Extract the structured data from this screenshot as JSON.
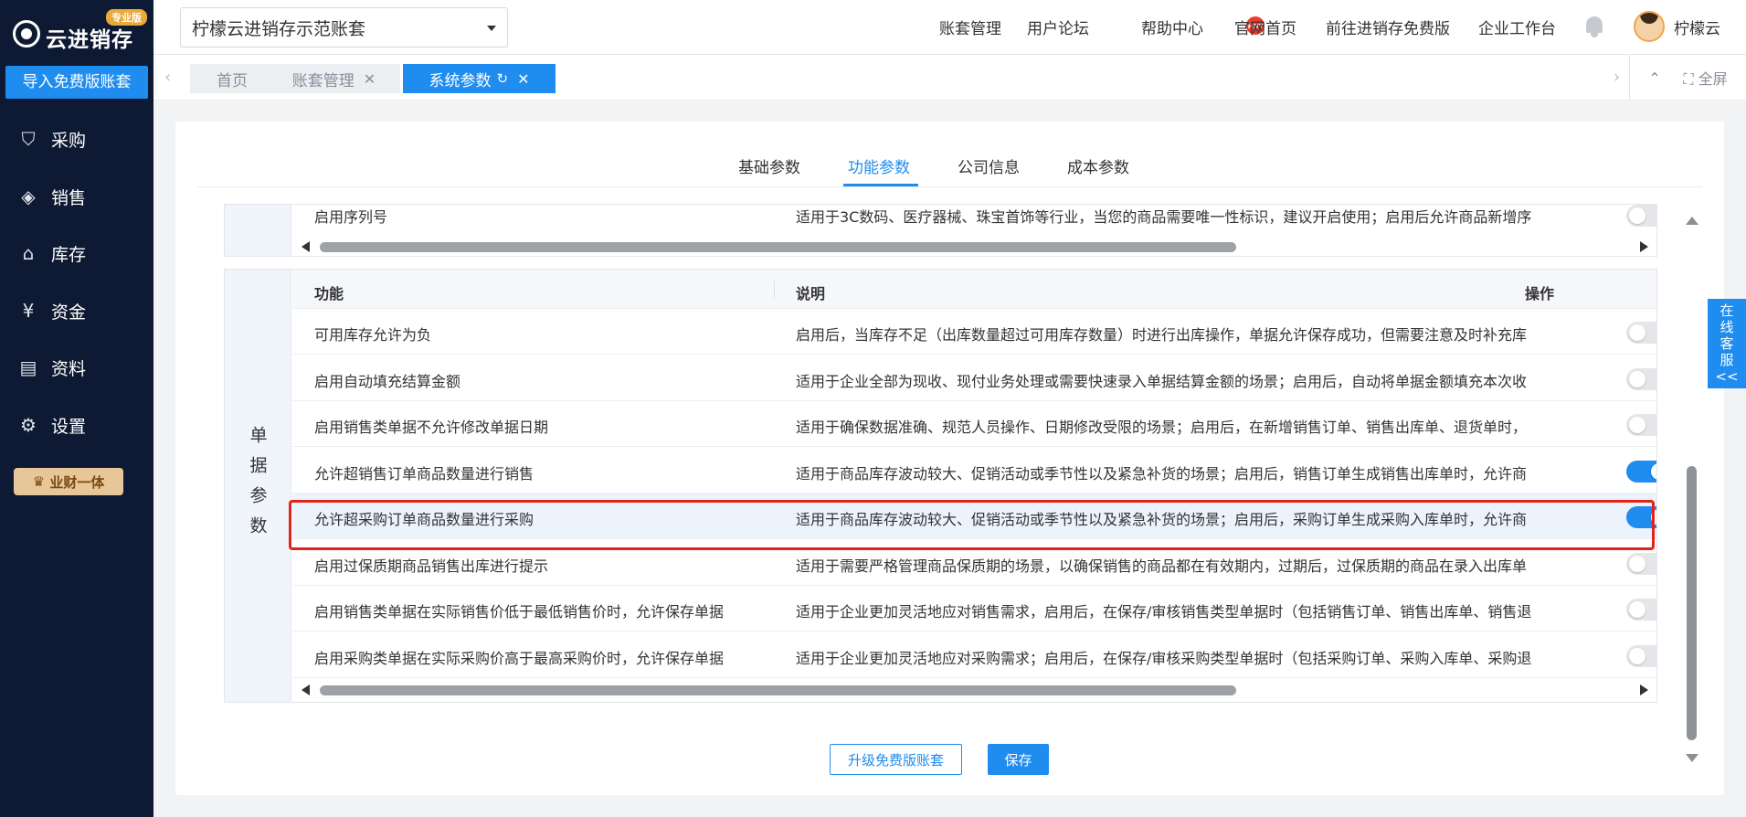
{
  "sidebar": {
    "logo_text": "云进销存",
    "logo_badge": "专业版",
    "import_button": "导入免费版账套",
    "items": [
      {
        "label": "采购",
        "icon": "bag-icon",
        "glyph": "⛉"
      },
      {
        "label": "销售",
        "icon": "price-tag-icon",
        "glyph": "◈"
      },
      {
        "label": "库存",
        "icon": "warehouse-icon",
        "glyph": "⌂"
      },
      {
        "label": "资金",
        "icon": "yen-coin-icon",
        "glyph": "¥"
      },
      {
        "label": "资料",
        "icon": "document-icon",
        "glyph": "▤"
      },
      {
        "label": "设置",
        "icon": "gear-icon",
        "glyph": "⚙"
      }
    ],
    "vip_label": "业财一体"
  },
  "topbar": {
    "account": "柠檬云进销存示范账套",
    "links": [
      "账套管理",
      "用户论坛",
      "帮助中心",
      "官网首页",
      "前往进销存免费版",
      "企业工作台"
    ],
    "hot_badge": "HOT",
    "username": "柠檬云"
  },
  "tabs": {
    "items": [
      "首页",
      "账套管理",
      "系统参数"
    ],
    "active": "系统参数",
    "fullscreen_label": "全屏"
  },
  "page_tabs": {
    "items": [
      "基础参数",
      "功能参数",
      "公司信息",
      "成本参数"
    ],
    "active": "功能参数"
  },
  "top_block": {
    "row": {
      "func": "启用序列号",
      "desc": "适用于3C数码、医疗器械、珠宝首饰等行业，当您的商品需要唯一性标识，建议开启使用；启用后允许商品新增序",
      "enabled": false
    }
  },
  "table": {
    "group_label": "单据参数",
    "headers": {
      "func": "功能",
      "desc": "说明",
      "op": "操作"
    },
    "rows": [
      {
        "func": "可用库存允许为负",
        "desc": "启用后，当库存不足（出库数量超过可用库存数量）时进行出库操作，单据允许保存成功，但需要注意及时补充库",
        "enabled": false
      },
      {
        "func": "启用自动填充结算金额",
        "desc": "适用于企业全部为现收、现付业务处理或需要快速录入单据结算金额的场景；启用后，自动将单据金额填充本次收",
        "enabled": false
      },
      {
        "func": "启用销售类单据不允许修改单据日期",
        "desc": "适用于确保数据准确、规范人员操作、日期修改受限的场景；启用后，在新增销售订单、销售出库单、退货单时，",
        "enabled": false
      },
      {
        "func": "允许超销售订单商品数量进行销售",
        "desc": "适用于商品库存波动较大、促销活动或季节性以及紧急补货的场景；启用后，销售订单生成销售出库单时，允许商",
        "enabled": true
      },
      {
        "func": "允许超采购订单商品数量进行采购",
        "desc": "适用于商品库存波动较大、促销活动或季节性以及紧急补货的场景；启用后，采购订单生成采购入库单时，允许商",
        "enabled": true,
        "highlighted": true
      },
      {
        "func": "启用过保质期商品销售出库进行提示",
        "desc": "适用于需要严格管理商品保质期的场景，以确保销售的商品都在有效期内，过期后，过保质期的商品在录入出库单",
        "enabled": false
      },
      {
        "func": "启用销售类单据在实际销售价低于最低销售价时，允许保存单据",
        "desc": "适用于企业更加灵活地应对销售需求，启用后，在保存/审核销售类型单据时（包括销售订单、销售出库单、销售退",
        "enabled": false
      },
      {
        "func": "启用采购类单据在实际采购价高于最高采购价时，允许保存单据",
        "desc": "适用于企业更加灵活地应对采购需求；启用后，在保存/审核采购类型单据时（包括采购订单、采购入库单、采购退",
        "enabled": false
      }
    ]
  },
  "buttons": {
    "upgrade": "升级免费版账套",
    "save": "保存"
  },
  "customer_service": [
    "在",
    "线",
    "客",
    "服",
    "<<"
  ],
  "colors": {
    "primary": "#1f8cf0",
    "sidebar_bg": "#0e1a33",
    "highlight_border": "#e2231a"
  }
}
